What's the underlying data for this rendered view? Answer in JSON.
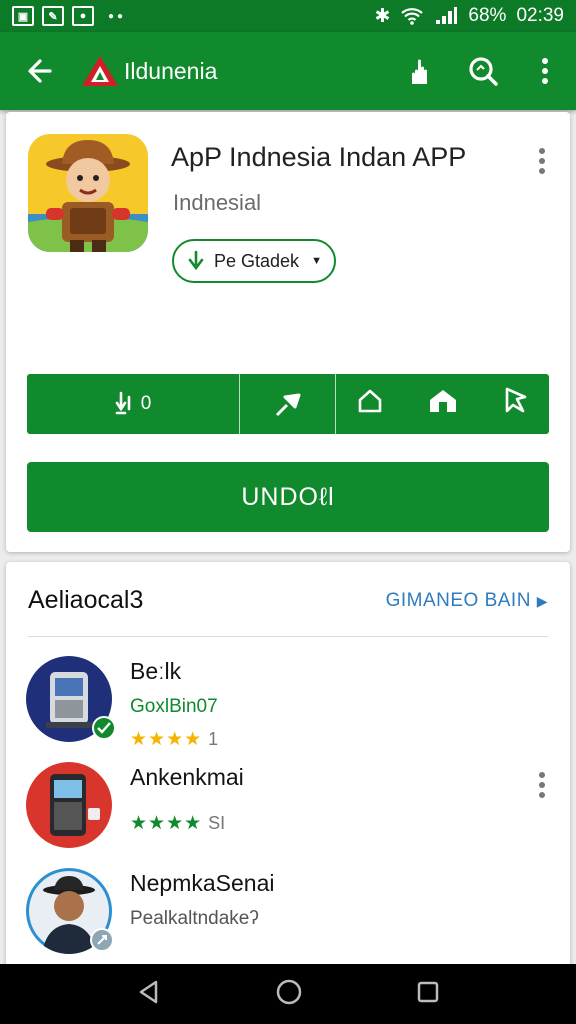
{
  "status_bar": {
    "battery": "68%",
    "time": "02:39"
  },
  "app_bar": {
    "logo_text": "Ildunenia"
  },
  "app": {
    "title": "ApP Indnesia Indan APP",
    "developer": "Indnesial",
    "category_chip": "Pe Gtadek"
  },
  "action_row": {
    "first_label": "0"
  },
  "install_label": "UNDOℓl",
  "related": {
    "title": "Aeliaocal3",
    "see_more": "GIMANEO BAIN",
    "items": [
      {
        "name": "Beːlk",
        "subtitle": "GoxlBin07",
        "stars": "★★★★",
        "rating": "1"
      },
      {
        "name": "Ankenkmai",
        "subtitle": "",
        "stars": "★★★★",
        "rating": "SI"
      },
      {
        "name": "NepmkaSenai",
        "subtitle": "Pealkaltndakeʔ",
        "stars": "",
        "rating": ""
      }
    ]
  },
  "colors": {
    "primary": "#118a2e",
    "status_bar": "#0d7a28",
    "link": "#2f7bbf",
    "star": "#f4b400"
  }
}
